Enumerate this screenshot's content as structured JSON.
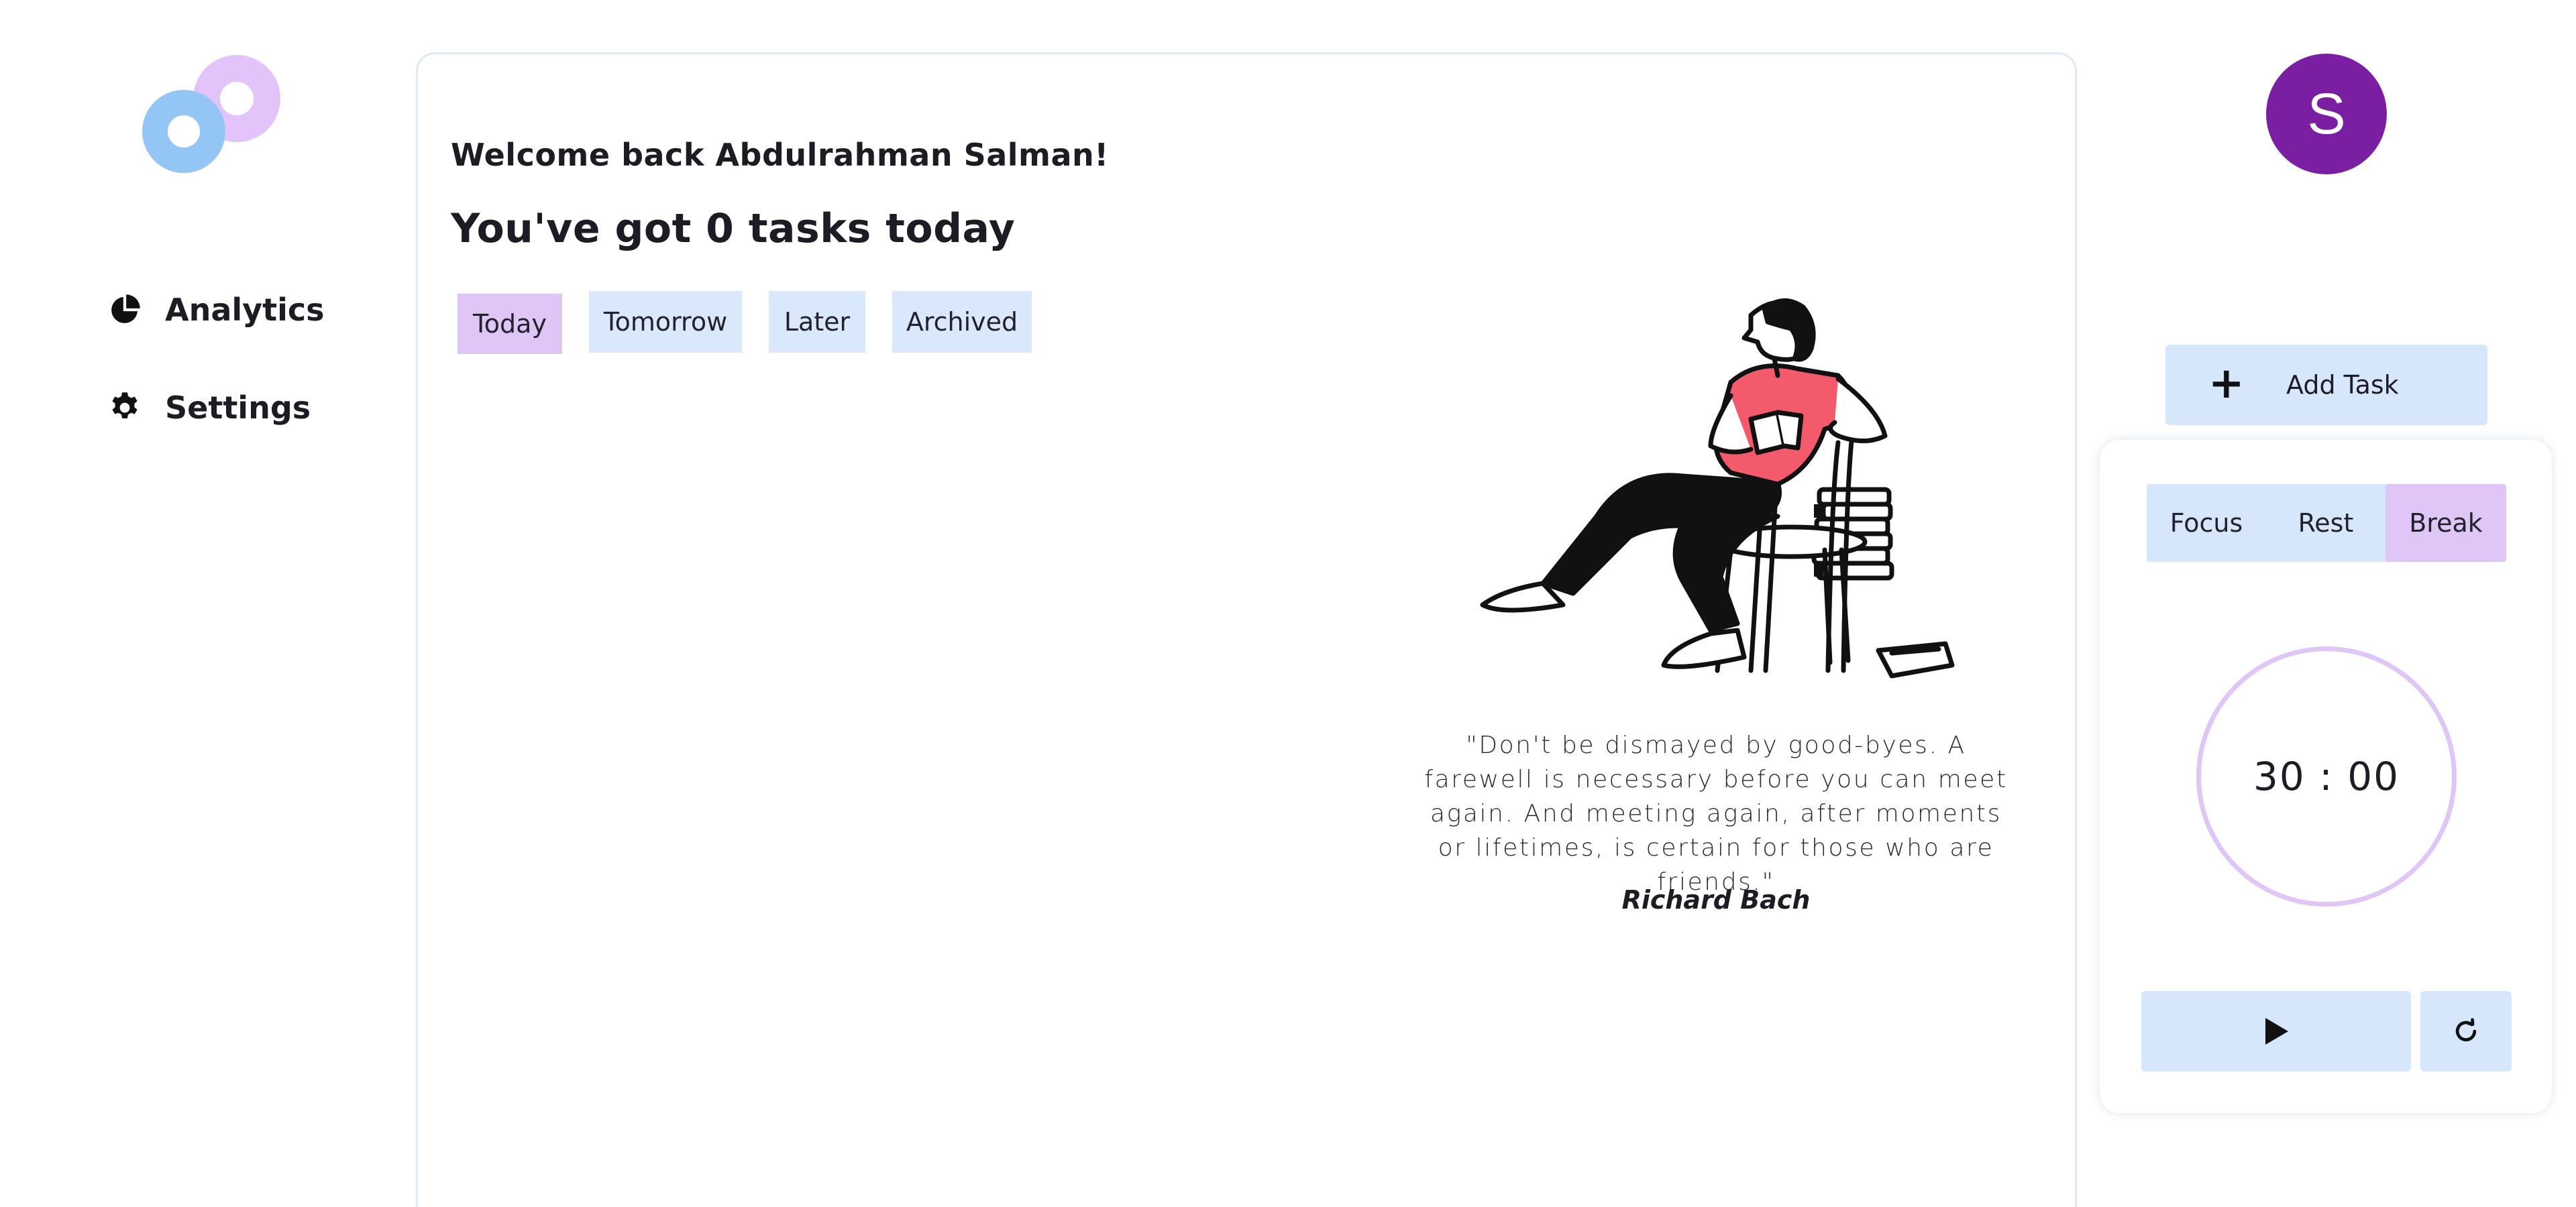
{
  "sidebar": {
    "logo_icon": "rings-logo-icon",
    "items": [
      {
        "label": "Analytics",
        "icon": "pie-chart-icon"
      },
      {
        "label": "Settings",
        "icon": "gear-icon"
      }
    ]
  },
  "main": {
    "welcome": "Welcome back Abdulrahman Salman!",
    "tasks_title": "You've got 0 tasks today",
    "tabs": [
      {
        "label": "Today",
        "active": true
      },
      {
        "label": "Tomorrow",
        "active": false
      },
      {
        "label": "Later",
        "active": false
      },
      {
        "label": "Archived",
        "active": false
      }
    ],
    "illustration": "person-reading-on-chair-illustration",
    "quote": "\"Don't be dismayed by good-byes. A farewell is necessary before you can meet again. And meeting again, after moments or lifetimes, is certain for those who are friends.\"",
    "quote_author": "Richard Bach"
  },
  "user": {
    "avatar_initial": "S"
  },
  "actions": {
    "add_task_label": "Add Task",
    "add_task_icon": "plus-icon"
  },
  "timer": {
    "modes": [
      {
        "label": "Focus",
        "active": false
      },
      {
        "label": "Rest",
        "active": false
      },
      {
        "label": "Break",
        "active": true
      }
    ],
    "display": "30 : 00",
    "play_icon": "play-icon",
    "reset_icon": "refresh-icon"
  },
  "colors": {
    "accent_purple": "#e0c5f7",
    "accent_blue": "#d6e6fb",
    "avatar": "#7a1fa2",
    "illustration_shirt": "#f35a6b"
  }
}
